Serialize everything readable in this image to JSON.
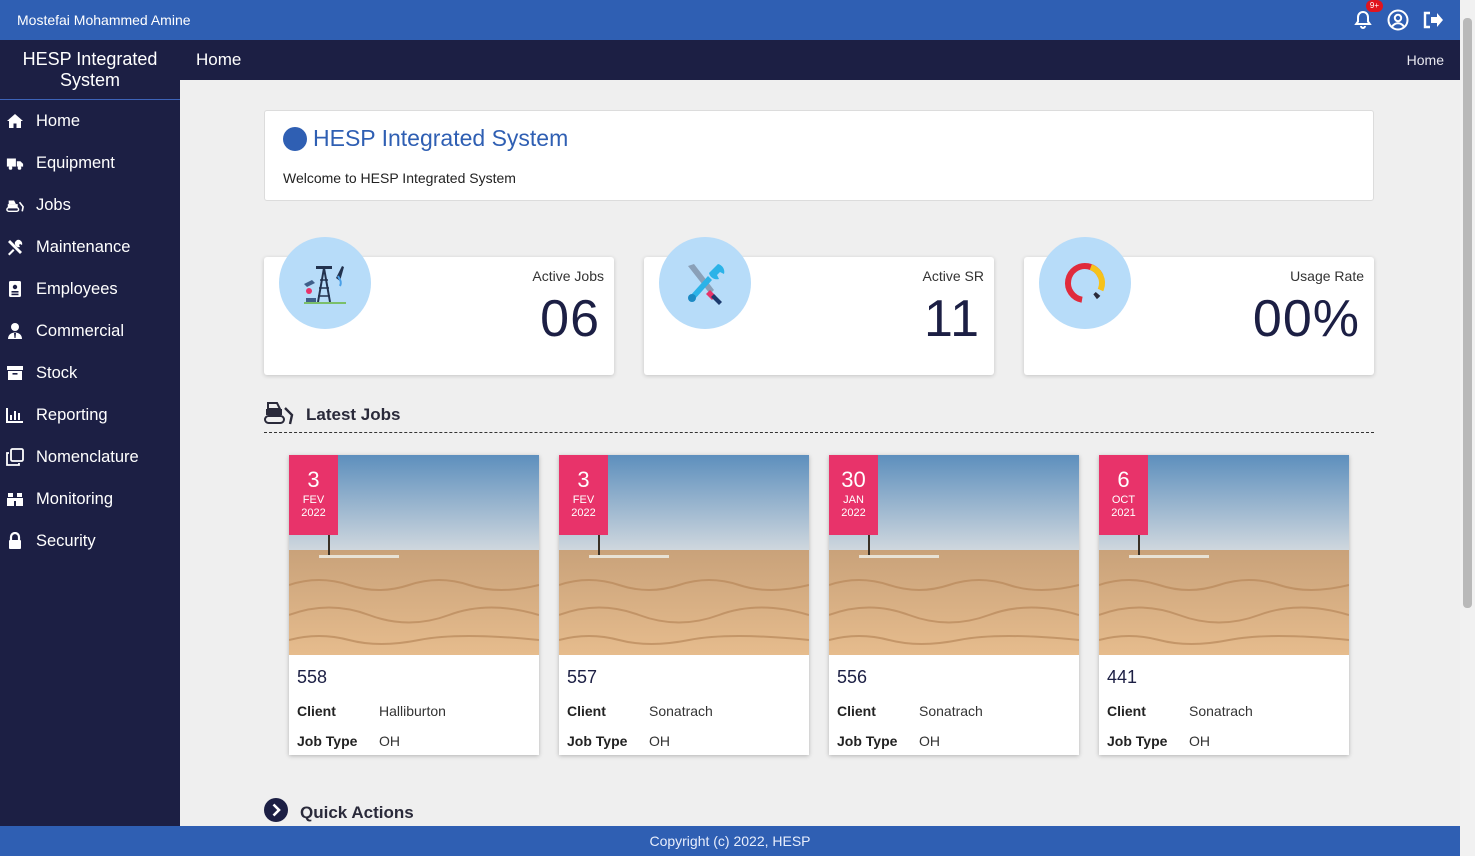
{
  "topbar": {
    "user_name": "Mostefai Mohammed Amine",
    "notification_badge": "9+"
  },
  "sidebar": {
    "brand": "HESP Integrated System",
    "items": [
      {
        "label": "Home",
        "icon": "home-icon"
      },
      {
        "label": "Equipment",
        "icon": "truck-icon"
      },
      {
        "label": "Jobs",
        "icon": "bulldozer-icon"
      },
      {
        "label": "Maintenance",
        "icon": "tools-icon"
      },
      {
        "label": "Employees",
        "icon": "id-badge-icon"
      },
      {
        "label": "Commercial",
        "icon": "user-tie-icon"
      },
      {
        "label": "Stock",
        "icon": "archive-icon"
      },
      {
        "label": "Reporting",
        "icon": "chart-icon"
      },
      {
        "label": "Nomenclature",
        "icon": "copy-icon"
      },
      {
        "label": "Monitoring",
        "icon": "binoculars-icon"
      },
      {
        "label": "Security",
        "icon": "lock-icon"
      }
    ]
  },
  "header": {
    "title": "Home",
    "breadcrumb": "Home"
  },
  "welcome": {
    "title": "HESP Integrated System",
    "subtitle": "Welcome to HESP Integrated System"
  },
  "stats": [
    {
      "label": "Active Jobs",
      "value": "06",
      "icon": "oil-rig-icon"
    },
    {
      "label": "Active SR",
      "value": "11",
      "icon": "tools-icon"
    },
    {
      "label": "Usage Rate",
      "value": "00%",
      "icon": "donut-chart-icon"
    }
  ],
  "latest_jobs": {
    "title": "Latest Jobs",
    "client_label": "Client",
    "job_type_label": "Job Type",
    "jobs": [
      {
        "day": "3",
        "month": "FEV",
        "year": "2022",
        "number": "558",
        "client": "Halliburton",
        "job_type": "OH"
      },
      {
        "day": "3",
        "month": "FEV",
        "year": "2022",
        "number": "557",
        "client": "Sonatrach",
        "job_type": "OH"
      },
      {
        "day": "30",
        "month": "JAN",
        "year": "2022",
        "number": "556",
        "client": "Sonatrach",
        "job_type": "OH"
      },
      {
        "day": "6",
        "month": "OCT",
        "year": "2021",
        "number": "441",
        "client": "Sonatrach",
        "job_type": "OH"
      }
    ]
  },
  "quick_actions": {
    "title": "Quick Actions"
  },
  "footer": {
    "copyright": "Copyright (c) 2022, HESP"
  },
  "colors": {
    "primary": "#2f5fb3",
    "sidebar": "#1c1f44",
    "date_badge": "#e8336a",
    "icon_circle": "#b7dcf9"
  }
}
